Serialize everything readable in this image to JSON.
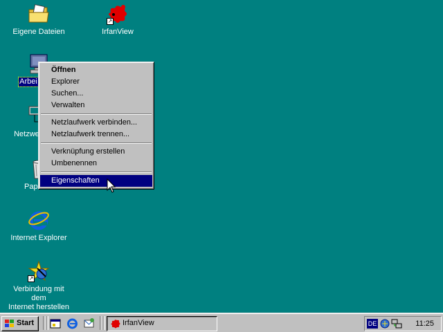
{
  "desktop": {
    "icons": [
      {
        "label": "Eigene Dateien",
        "icon": "my-documents-icon"
      },
      {
        "label": "IrfanView",
        "icon": "irfanview-icon"
      },
      {
        "label": "Arbei",
        "icon": "my-computer-icon"
      },
      {
        "label": "Netzwerk",
        "icon": "network-neighborhood-icon"
      },
      {
        "label": "Papi",
        "icon": "recycle-bin-icon"
      },
      {
        "label": "Internet Explorer",
        "icon": "internet-explorer-icon"
      },
      {
        "label": "Verbindung mit dem\nInternet herstellen",
        "icon": "connect-wizard-icon"
      }
    ]
  },
  "context_menu": {
    "items": [
      {
        "label": "Öffnen"
      },
      {
        "label": "Explorer"
      },
      {
        "label": "Suchen..."
      },
      {
        "label": "Verwalten"
      },
      {
        "label": "Netzlaufwerk verbinden..."
      },
      {
        "label": "Netzlaufwerk trennen..."
      },
      {
        "label": "Verknüpfung erstellen"
      },
      {
        "label": "Umbenennen"
      },
      {
        "label": "Eigenschaften"
      }
    ]
  },
  "taskbar": {
    "start_label": "Start",
    "quick_launch": [
      "show-desktop-icon",
      "internet-explorer-icon",
      "outlook-express-icon"
    ],
    "task_label": "IrfanView",
    "tray": {
      "language": "DE",
      "clock": "11:25"
    }
  },
  "colors": {
    "desktop": "#008080",
    "highlight": "#000080",
    "face": "#c0c0c0"
  }
}
